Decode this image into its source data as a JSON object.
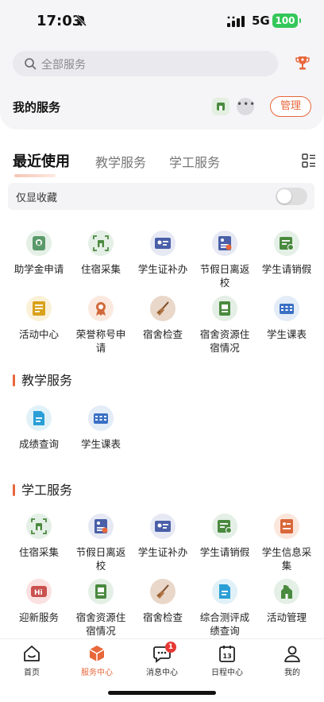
{
  "status_bar": {
    "time": "17:03",
    "network": "5G",
    "battery": "100"
  },
  "search": {
    "placeholder": "全部服务"
  },
  "my_services": {
    "title": "我的服务",
    "more": "•••",
    "manage_label": "管理"
  },
  "tabs": [
    {
      "label": "最近使用"
    },
    {
      "label": "教学服务"
    },
    {
      "label": "学工服务"
    }
  ],
  "favorites_toggle": {
    "label": "仅显收藏",
    "on": false
  },
  "recent_items": [
    {
      "label": "助学金申请",
      "icon": "grant-icon"
    },
    {
      "label": "住宿采集",
      "icon": "dorm-scan-icon"
    },
    {
      "label": "学生证补办",
      "icon": "id-card-icon"
    },
    {
      "label": "节假日离返校",
      "icon": "holiday-icon"
    },
    {
      "label": "学生请销假",
      "icon": "leave-icon"
    },
    {
      "label": "活动中心",
      "icon": "activity-icon"
    },
    {
      "label": "荣誉称号申请",
      "icon": "medal-icon"
    },
    {
      "label": "宿舍检查",
      "icon": "broom-icon"
    },
    {
      "label": "宿舍资源住宿情况",
      "icon": "dorm-resource-icon"
    },
    {
      "label": "学生课表",
      "icon": "timetable-icon"
    }
  ],
  "sections": {
    "teaching": {
      "title": "教学服务",
      "items": [
        {
          "label": "成绩查询",
          "icon": "grades-icon"
        },
        {
          "label": "学生课表",
          "icon": "timetable-icon"
        }
      ]
    },
    "student_affairs": {
      "title": "学工服务",
      "items": [
        {
          "label": "住宿采集",
          "icon": "dorm-scan-icon"
        },
        {
          "label": "节假日离返校",
          "icon": "holiday-icon"
        },
        {
          "label": "学生证补办",
          "icon": "id-card-icon"
        },
        {
          "label": "学生请销假",
          "icon": "leave-icon"
        },
        {
          "label": "学生信息采集",
          "icon": "info-collect-icon"
        },
        {
          "label": "迎新服务",
          "icon": "welcome-icon"
        },
        {
          "label": "宿舍资源住宿情况",
          "icon": "dorm-resource-icon"
        },
        {
          "label": "宿舍检查",
          "icon": "broom-icon"
        },
        {
          "label": "综合测评成绩查询",
          "icon": "evaluation-icon"
        },
        {
          "label": "活动管理",
          "icon": "activity-manage-icon"
        }
      ]
    }
  },
  "bottom_nav": [
    {
      "label": "首页"
    },
    {
      "label": "服务中心"
    },
    {
      "label": "消息中心",
      "badge": "1"
    },
    {
      "label": "日程中心",
      "day": "13"
    },
    {
      "label": "我的"
    }
  ],
  "colors": {
    "accent": "#e8673b",
    "green": "#34c759",
    "badge": "#e53935"
  }
}
